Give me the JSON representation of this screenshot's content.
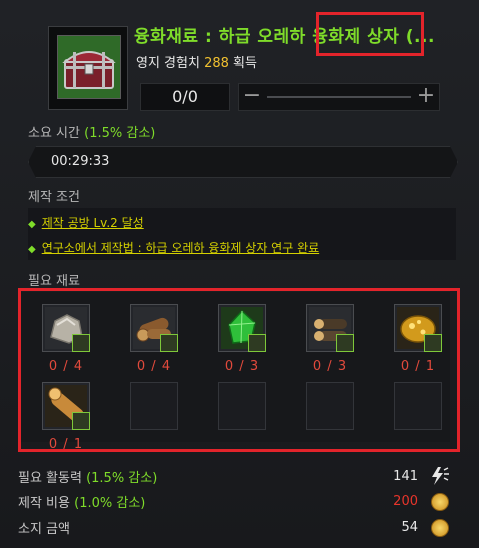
{
  "header": {
    "title": "융화재료 : 하급 오레하 융화제 상자 (...",
    "exp_label": "영지 경험치",
    "exp_value": "288",
    "exp_suffix": "획득",
    "count": "0/0",
    "minus": "−",
    "plus": "+"
  },
  "time": {
    "label": "소요 시간",
    "reduction": "(1.5% 감소)",
    "value": "00:29:33"
  },
  "conditions": {
    "label": "제작 조건",
    "items": [
      "제작 공방 Lv.2 달성",
      "연구소에서 제작법 : 하급 오레하 융화제 상자 연구 완료"
    ]
  },
  "materials": {
    "label": "필요 재료",
    "items": [
      {
        "icon": "stone-ore-icon",
        "qty": "0 / 4"
      },
      {
        "icon": "timber-icon",
        "qty": "0 / 4"
      },
      {
        "icon": "green-crystal-icon",
        "qty": "0 / 3"
      },
      {
        "icon": "sturdy-timber-icon",
        "qty": "0 / 3"
      },
      {
        "icon": "gold-ore-icon",
        "qty": "0 / 1"
      },
      {
        "icon": "log-icon",
        "qty": "0 / 1"
      }
    ]
  },
  "footer": {
    "energy_label": "필요 활동력",
    "energy_reduction": "(1.5% 감소)",
    "energy_value": "141",
    "cost_label": "제작 비용",
    "cost_reduction": "(1.0% 감소)",
    "cost_value": "200",
    "owned_label": "소지 금액",
    "owned_value": "54"
  },
  "colors": {
    "accent_green": "#7fdc2a",
    "highlight_red": "#e3242b",
    "cost_red": "#e8352b",
    "exp_yellow": "#f0c030"
  }
}
